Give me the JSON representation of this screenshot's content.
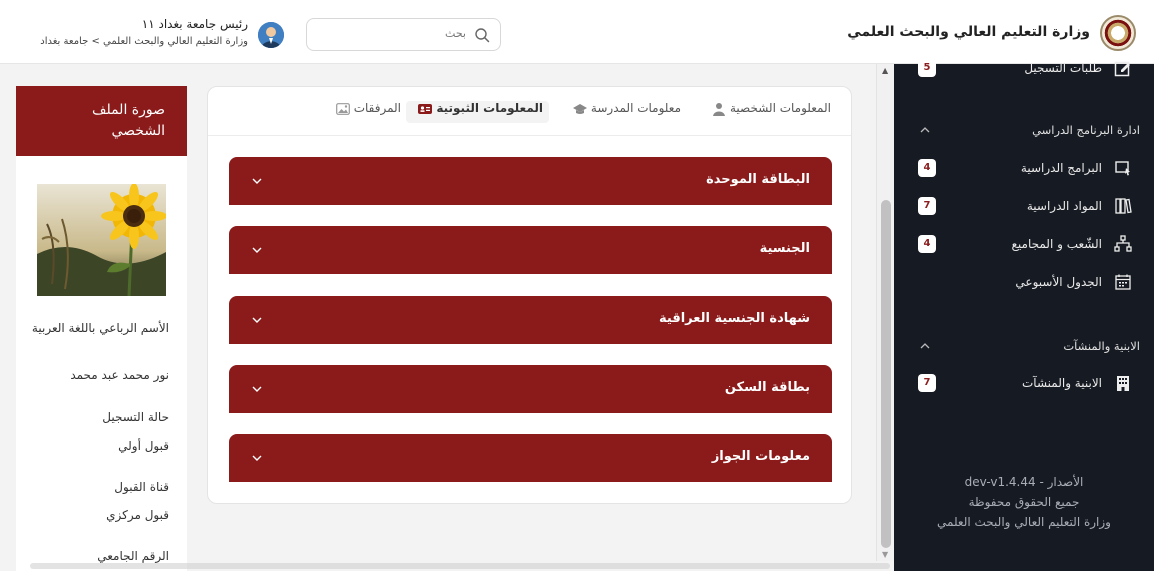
{
  "header": {
    "ministry_title": "وزارة التعليم العالي والبحث العلمي",
    "search_placeholder": "بحث",
    "user_name": "رئيس جامعة بغداد ١١",
    "user_path": "وزارة التعليم العالي والبحث العلمي > جامعة بغداد"
  },
  "sidebar": {
    "top_item": {
      "label": "طلبات التسجيل",
      "badge": "5"
    },
    "groups": [
      {
        "label": "ادارة البرنامج الدراسي",
        "items": [
          {
            "label": "البرامج الدراسية",
            "badge": "4",
            "icon": "program-icon"
          },
          {
            "label": "المواد الدراسية",
            "badge": "7",
            "icon": "books-icon"
          },
          {
            "label": "الشّعب و المجاميع",
            "badge": "4",
            "icon": "hierarchy-icon"
          },
          {
            "label": "الجدول الأسبوعي",
            "badge": "",
            "icon": "calendar-icon"
          }
        ]
      },
      {
        "label": "الابنية والمنشآت",
        "items": [
          {
            "label": "الابنية والمنشآت",
            "badge": "7",
            "icon": "building-icon"
          }
        ]
      }
    ],
    "footer": {
      "version": "الأصدار - dev-v1.4.44",
      "rights": "جميع الحقوق محفوظة",
      "owner": "وزارة التعليم العالي والبحث العلمي"
    }
  },
  "profile": {
    "title": "صورة الملف الشخصي",
    "fields": [
      "الأسم الرباعي باللغة العربية",
      "نور محمد عبد محمد",
      "حالة التسجيل",
      "قبول أولي",
      "قناة القبول",
      "قبول مركزي",
      "الرقم الجامعي"
    ]
  },
  "tabs": [
    {
      "label": "المعلومات الشخصية",
      "icon": "person-icon",
      "active": false
    },
    {
      "label": "معلومات المدرسة",
      "icon": "graduation-cap-icon",
      "active": false
    },
    {
      "label": "المعلومات الثبوتية",
      "icon": "id-card-icon",
      "active": true
    },
    {
      "label": "المرفقات",
      "icon": "image-icon",
      "active": false
    }
  ],
  "accordions": [
    "البطاقة الموحدة",
    "الجنسية",
    "شهادة الجنسية العراقية",
    "بطاقة السكن",
    "معلومات الجواز"
  ],
  "colors": {
    "primary": "#8b1a1a",
    "sidebar_bg": "#161a22",
    "badge_text": "#8b1f1f"
  }
}
